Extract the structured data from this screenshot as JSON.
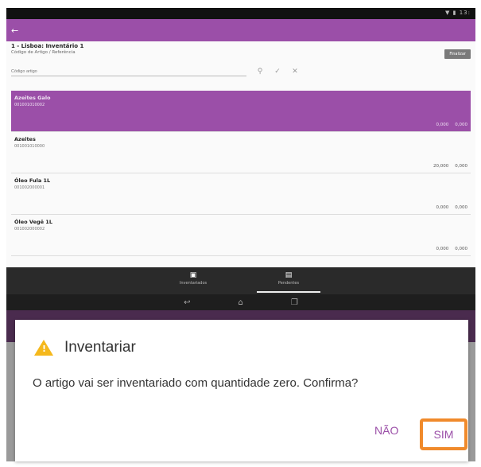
{
  "statusbar": {
    "text": "▼ ▮ 13:"
  },
  "header": {
    "title": "1 - Lisboa: Inventário 1",
    "subtitle": "Código de Artigo / Referência",
    "finalize_label": "Finalizar"
  },
  "search": {
    "placeholder": "Código artigo"
  },
  "items": [
    {
      "name": "Azeites Galo",
      "code": "001001010002",
      "qty1": "0,000",
      "qty2": "0,000"
    },
    {
      "name": "Azeites",
      "code": "001001010000",
      "qty1": "20,000",
      "qty2": "0,000"
    },
    {
      "name": "Óleo Fula 1L",
      "code": "001002000001",
      "qty1": "0,000",
      "qty2": "0,000"
    },
    {
      "name": "Óleo Vegê 1L",
      "code": "001002000002",
      "qty1": "0,000",
      "qty2": "0,000"
    }
  ],
  "bottom_tabs": [
    {
      "label": "Inventariados"
    },
    {
      "label": "Pendentes"
    }
  ],
  "dialog": {
    "title": "Inventariar",
    "message": "O artigo vai ser inventariado com quantidade zero. Confirma?",
    "no_label": "NÃO",
    "yes_label": "SIM"
  },
  "colors": {
    "accent": "#9b4fa8",
    "highlight": "#f08a2b",
    "warning": "#f5b81c"
  }
}
